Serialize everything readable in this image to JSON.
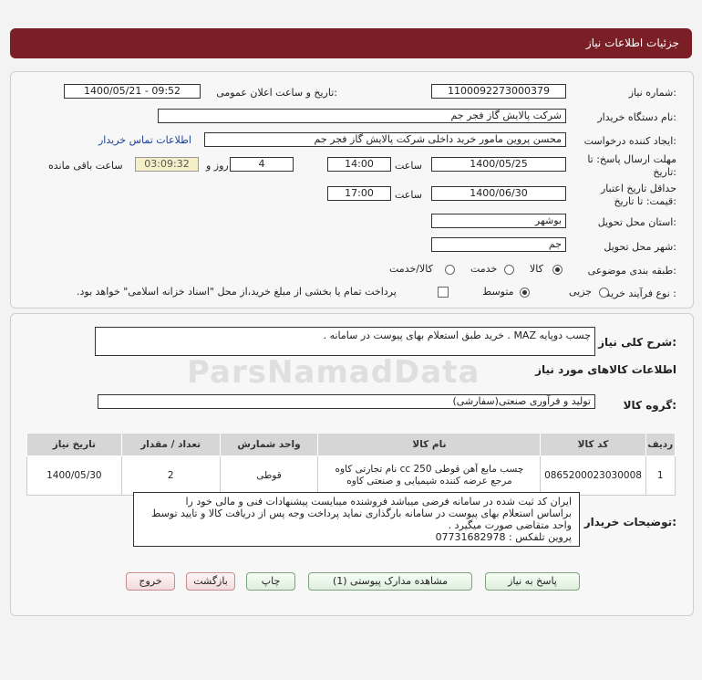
{
  "header": {
    "title": "جزئیات اطلاعات نیاز"
  },
  "form": {
    "need_number_label": "شماره نیاز:",
    "need_number": "1100092273000379",
    "announce_label": "تاریخ و ساعت اعلان عمومی:",
    "announce_value": "1400/05/21 - 09:52",
    "buyer_label": "نام دستگاه خریدار:",
    "buyer_value": "شرکت پالایش گاز فجر جم",
    "creator_label": "ایجاد کننده درخواست:",
    "creator_value": "محسن پروین مامور خرید داخلی شرکت پالایش گاز فجر جم",
    "contact_link": "اطلاعات تماس خریدار",
    "deadline_label_1": "مهلت ارسال پاسخ: تا",
    "deadline_label_2": "تاریخ:",
    "deadline_date": "1400/05/25",
    "time_label": "ساعت",
    "deadline_time": "14:00",
    "days_value": "4",
    "days_label": "روز و",
    "remaining_value": "03:09:32",
    "remaining_label": "ساعت باقی مانده",
    "validity_label_1": "حداقل تاریخ اعتبار",
    "validity_label_2": "قیمت: تا تاریخ:",
    "validity_date": "1400/06/30",
    "validity_time_label": "ساعت",
    "validity_time": "17:00",
    "province_label": "استان محل تحویل:",
    "province_value": "بوشهر",
    "city_label": "شهر محل تحویل:",
    "city_value": "جم",
    "category_label": "طبقه بندی موضوعی:",
    "category_options": [
      "کالا",
      "خدمت",
      "کالا/خدمت"
    ],
    "process_label": "نوع فرآیند خرید :",
    "process_options": [
      "جزیی",
      "متوسط"
    ],
    "treasury_note": "پرداخت تمام یا بخشی از مبلغ خرید،از محل \"اسناد خزانه اسلامی\" خواهد بود."
  },
  "details": {
    "summary_label": "شرح کلی نیاز:",
    "summary_value": "چسب دوپایه MAZ  . خرید طبق استعلام بهای پیوست در سامانه .",
    "items_heading": "اطلاعات کالاهای مورد نیاز",
    "group_label": "گروه کالا:",
    "group_value": "تولید و فرآوری صنعتی(سفارشی)",
    "table": {
      "headers": [
        "ردیف",
        "کد کالا",
        "نام کالا",
        "واحد شمارش",
        "تعداد / مقدار",
        "تاریخ نیاز"
      ],
      "rows": [
        [
          "1",
          "0865200023030008",
          "چسب مایع آهن قوطی 250 cc نام تجارتی کاوه مرجع عرضه کننده شیمیایی و صنعتی کاوه",
          "قوطی",
          "2",
          "1400/05/30"
        ]
      ]
    },
    "notes_label": "توضیحات خریدار:",
    "notes_lines": [
      "ایران کد ثبت شده در سامانه فرضی میباشد فروشنده میبایست پیشنهادات فنی و مالی خود را",
      "براساس استعلام بهای پیوست در سامانه بارگذاری نماید پرداخت وجه پس از دریافت کالا و تایید توسط",
      "واحد متقاضی صورت میگیرد .",
      "پروین   تلفکس : 07731682978"
    ]
  },
  "buttons": {
    "reply": "پاسخ به نیاز",
    "attachments": "مشاهده مدارک پیوستی (1)",
    "print": "چاپ",
    "back": "بازگشت",
    "exit": "خروج"
  },
  "watermark": "ParsNamadData",
  "colors": {
    "title_bar": "#7a1f26",
    "link": "#1a3f9c",
    "remaining_bg": "#f5efc8"
  }
}
